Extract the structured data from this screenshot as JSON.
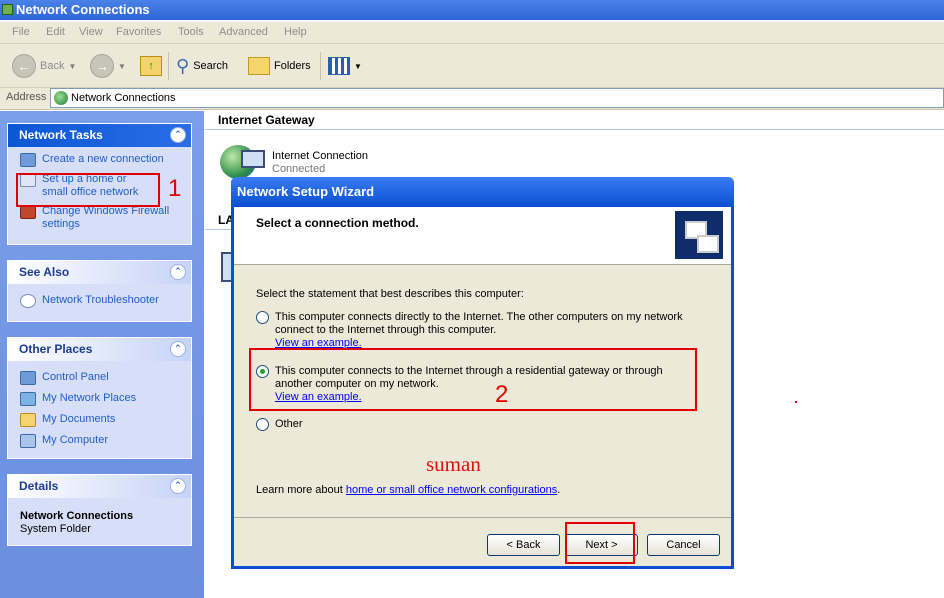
{
  "window": {
    "title": "Network Connections"
  },
  "menu": [
    "File",
    "Edit",
    "View",
    "Favorites",
    "Tools",
    "Advanced",
    "Help"
  ],
  "toolbar": {
    "back": "Back",
    "search": "Search",
    "folders": "Folders"
  },
  "address": {
    "label": "Address",
    "value": "Network Connections"
  },
  "panes": {
    "network_tasks": {
      "title": "Network Tasks",
      "items": [
        "Create a new connection",
        "Set up a home or small office network",
        "Change Windows Firewall settings"
      ]
    },
    "see_also": {
      "title": "See Also",
      "items": [
        "Network Troubleshooter"
      ]
    },
    "other_places": {
      "title": "Other Places",
      "items": [
        "Control Panel",
        "My Network Places",
        "My Documents",
        "My Computer"
      ]
    },
    "details": {
      "title": "Details",
      "name": "Network Connections",
      "type": "System Folder"
    }
  },
  "content": {
    "group_gateway": "Internet Gateway",
    "conn_name": "Internet Connection",
    "conn_status": "Connected",
    "group_lan": "LA"
  },
  "wizard": {
    "title": "Network Setup Wizard",
    "heading": "Select a connection method.",
    "prompt": "Select the statement that best describes this computer:",
    "options": [
      {
        "text": "This computer connects directly to the Internet. The other computers on my network connect to the Internet through this computer.",
        "link": "View an example.",
        "selected": false
      },
      {
        "text": "This computer connects to the Internet through a residential gateway or through another computer on my network.",
        "link": "View an example.",
        "selected": true
      },
      {
        "text": "Other",
        "link": "",
        "selected": false
      }
    ],
    "learn_prefix": "Learn more about ",
    "learn_link": "home or small office network configurations",
    "learn_suffix": ".",
    "buttons": {
      "back": "< Back",
      "next": "Next >",
      "cancel": "Cancel"
    }
  },
  "annotations": {
    "num1": "1",
    "num2": "2",
    "watermark": "suman"
  }
}
